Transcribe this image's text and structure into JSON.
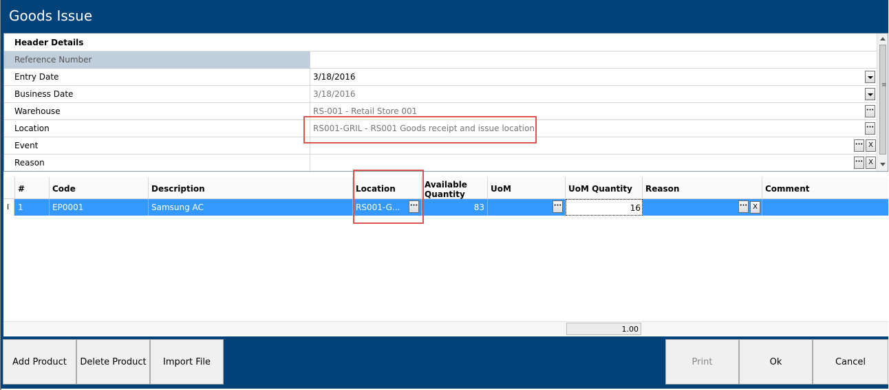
{
  "window": {
    "title": "Goods Issue"
  },
  "header": {
    "title": "Header Details",
    "rows": [
      {
        "label": "Reference Number",
        "value": ""
      },
      {
        "label": "Entry Date",
        "value": "3/18/2016"
      },
      {
        "label": "Business Date",
        "value": "3/18/2016"
      },
      {
        "label": "Warehouse",
        "value": "RS-001 - Retail Store 001"
      },
      {
        "label": "Location",
        "value": "RS001-GRIL - RS001 Goods receipt and issue location"
      },
      {
        "label": "Event",
        "value": ""
      },
      {
        "label": "Reason",
        "value": ""
      }
    ]
  },
  "grid": {
    "columns": {
      "num": "#",
      "code": "Code",
      "description": "Description",
      "location": "Location",
      "available_quantity": "Available Quantity",
      "uom": "UoM",
      "uom_quantity": "UoM Quantity",
      "reason": "Reason",
      "comment": "Comment"
    },
    "rows": [
      {
        "num": "1",
        "code": "EP0001",
        "description": "Samsung AC",
        "location": "RS001-G...",
        "available_quantity": "83",
        "uom": "",
        "uom_quantity": "16",
        "reason": "",
        "comment": ""
      }
    ],
    "row_indicator": "I",
    "footer_total": "1.00"
  },
  "buttons": {
    "add_product": "Add Product",
    "delete_product": "Delete Product",
    "import_file": "Import File",
    "print": "Print",
    "ok": "Ok",
    "cancel": "Cancel"
  },
  "colors": {
    "title_bar": "#04427a",
    "selected_row": "#3399ff",
    "highlight": "#d9534f",
    "readonly_label": "#c1cedb"
  }
}
